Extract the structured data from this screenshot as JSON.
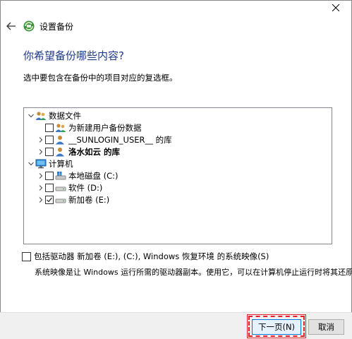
{
  "window": {
    "title": "设置备份",
    "close_icon": "close-icon",
    "back_icon": "back-arrow-icon",
    "app_icon": "backup-icon"
  },
  "heading": "你希望备份哪些内容?",
  "instruction": "选中要包含在备份中的项目对应的复选框。",
  "tree": {
    "groups": [
      {
        "label": "数据文件",
        "icon": "users-icon",
        "expanded": true,
        "children": [
          {
            "label": "为新建用户备份数据",
            "checked": false,
            "has_chevron": false,
            "bold": false
          },
          {
            "label": "__SUNLOGIN_USER__ 的库",
            "checked": false,
            "has_chevron": true,
            "bold": false
          },
          {
            "label": "洛水如云 的库",
            "checked": false,
            "has_chevron": true,
            "bold": true
          }
        ]
      },
      {
        "label": "计算机",
        "icon": "computer-icon",
        "expanded": true,
        "children": [
          {
            "label": "本地磁盘 (C:)",
            "checked": false,
            "has_chevron": true
          },
          {
            "label": "软件 (D:)",
            "checked": false,
            "has_chevron": true
          },
          {
            "label": "新加卷 (E:)",
            "checked": true,
            "has_chevron": true
          }
        ]
      }
    ]
  },
  "system_image": {
    "label": "包括驱动器 新加卷 (E:), (C:), Windows 恢复环境 的系统映像(S)",
    "checked": false,
    "description": "系统映像是让 Windows 运行所需的驱动器副本。使用它，可以在计算机停止运行时将其还原。"
  },
  "buttons": {
    "next": "下一页(N)",
    "cancel": "取消"
  },
  "colors": {
    "heading": "#1e3a8a",
    "highlight": "#e0202a",
    "default_button_border": "#0078d7"
  }
}
